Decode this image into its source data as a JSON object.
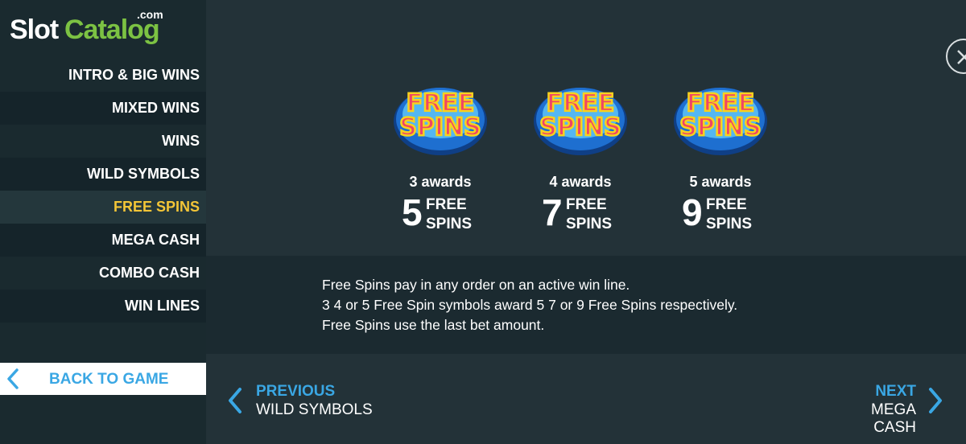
{
  "brand": {
    "slot": "Slot",
    "catalog": "Catalog",
    "dotcom": ".com"
  },
  "sidebar": {
    "items": [
      {
        "label": "INTRO & BIG WINS"
      },
      {
        "label": "MIXED WINS"
      },
      {
        "label": "WINS"
      },
      {
        "label": "WILD SYMBOLS"
      },
      {
        "label": "FREE SPINS",
        "active": true
      },
      {
        "label": "MEGA CASH"
      },
      {
        "label": "COMBO CASH"
      },
      {
        "label": "WIN LINES"
      }
    ],
    "back_label": "BACK TO GAME"
  },
  "symbol": {
    "line1": "FREE",
    "line2": "SPINS"
  },
  "awards": [
    {
      "label": "3 awards",
      "count": "5",
      "unit_line1": "FREE",
      "unit_line2": "SPINS"
    },
    {
      "label": "4 awards",
      "count": "7",
      "unit_line1": "FREE",
      "unit_line2": "SPINS"
    },
    {
      "label": "5 awards",
      "count": "9",
      "unit_line1": "FREE",
      "unit_line2": "SPINS"
    }
  ],
  "info": {
    "lines": [
      "Free Spins pay in any order on an active win line.",
      "3 4 or 5 Free Spin symbols award 5 7 or 9 Free Spins respectively.",
      "Free Spins use the last bet amount."
    ]
  },
  "nav": {
    "prev_label": "PREVIOUS",
    "prev_dest": "WILD SYMBOLS",
    "next_label": "NEXT",
    "next_dest": "MEGA CASH"
  },
  "colors": {
    "background": "#233238",
    "sidebar": "#1a2a2f",
    "accent_blue": "#3aa7e4",
    "active_yellow": "#f3c537",
    "brand_green": "#7cc243"
  },
  "icons": [
    "close-icon",
    "chevron-left-icon",
    "chevron-right-icon",
    "free-spins-symbol-icon"
  ]
}
